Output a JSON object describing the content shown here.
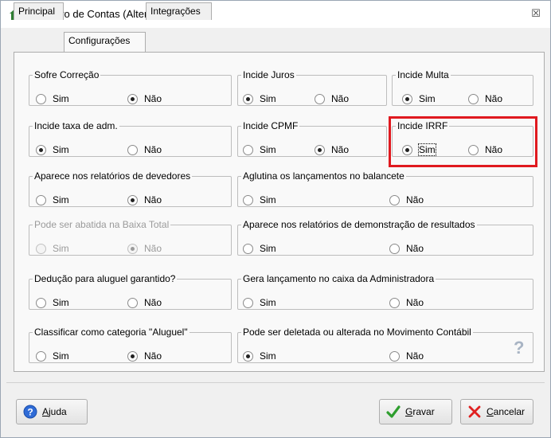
{
  "window": {
    "title": "Cadastro de Contas (Alteração)",
    "close_glyph": "☒"
  },
  "tabs": [
    {
      "label": "Principal"
    },
    {
      "label": "Configurações",
      "active": true
    },
    {
      "label": "Integrações"
    }
  ],
  "options": {
    "yes": "Sim",
    "no": "Não"
  },
  "groups": {
    "sofre_correcao": {
      "legend": "Sofre Correção",
      "selected": "Não"
    },
    "incide_juros": {
      "legend": "Incide Juros",
      "selected": "Sim"
    },
    "incide_multa": {
      "legend": "Incide Multa",
      "selected": "Sim"
    },
    "incide_taxa_adm": {
      "legend": "Incide taxa de adm.",
      "selected": "Sim"
    },
    "incide_cpmf": {
      "legend": "Incide CPMF",
      "selected": "Não"
    },
    "incide_irrf": {
      "legend": "Incide IRRF",
      "selected": "Sim",
      "highlighted": true
    },
    "aparece_devedores": {
      "legend": "Aparece nos relatórios de devedores",
      "selected": "Não"
    },
    "aglutina_balancete": {
      "legend": "Aglutina os lançamentos no balancete",
      "selected": null
    },
    "abatida_baixa_total": {
      "legend": "Pode ser abatida na Baixa Total",
      "selected": "Não",
      "disabled": true
    },
    "aparece_demonstracao": {
      "legend": "Aparece nos relatórios de demonstração de resultados",
      "selected": null
    },
    "deducao_aluguel": {
      "legend": " Dedução para aluguel garantido?",
      "selected": null
    },
    "gera_lancamento_caixa": {
      "legend": "Gera lançamento no caixa da Administradora",
      "selected": null
    },
    "classificar_aluguel": {
      "legend": "Classificar como categoria \"Aluguel\"",
      "selected": "Não"
    },
    "pode_deletada": {
      "legend": " Pode ser deletada ou alterada no Movimento Contábil",
      "selected": "Sim"
    }
  },
  "help_mark": "?",
  "buttons": {
    "ajuda": {
      "mnemonic": "A",
      "rest": "juda"
    },
    "gravar": {
      "mnemonic": "G",
      "rest": "ravar"
    },
    "cancelar": {
      "mnemonic": "C",
      "rest": "ancelar"
    }
  },
  "colors": {
    "highlight": "#e0191f",
    "title_icon": "#2e7d32",
    "check_icon": "#2e9e2e",
    "cancel_icon": "#e02020"
  },
  "icons": [
    "house-icon",
    "close-icon",
    "help-icon",
    "check-icon",
    "x-icon"
  ]
}
